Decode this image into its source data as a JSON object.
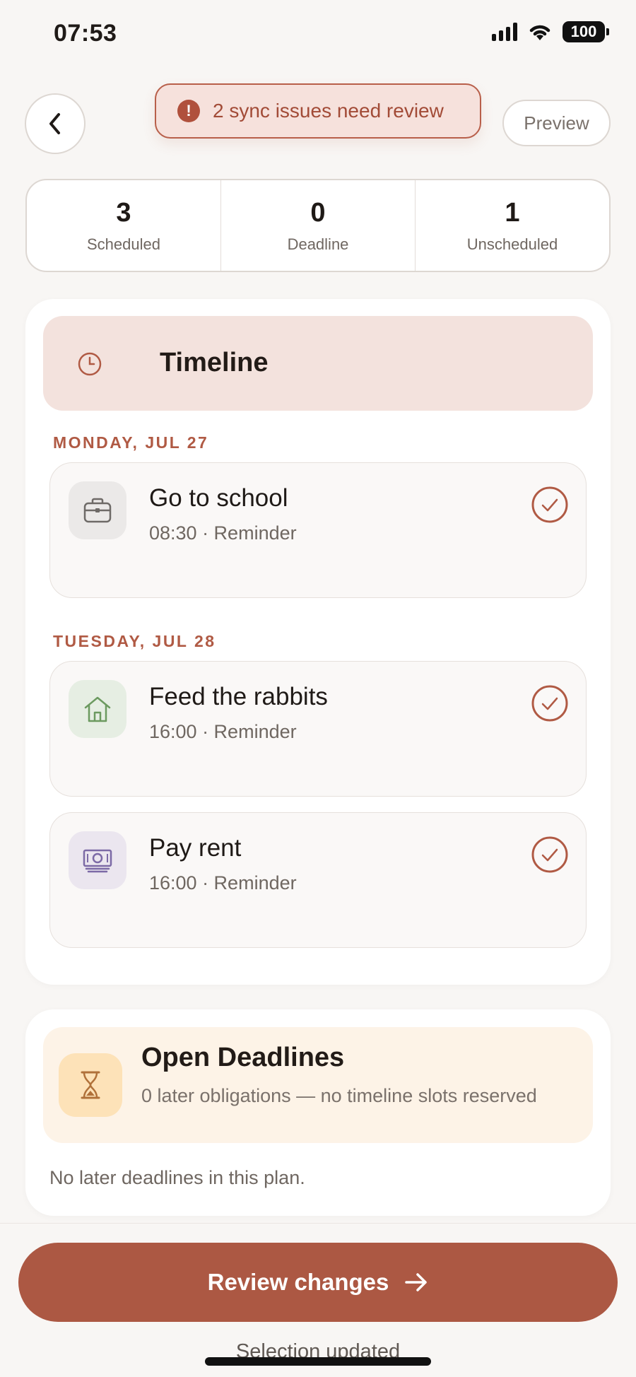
{
  "status_bar": {
    "time": "07:53",
    "battery": "100"
  },
  "header": {
    "sync_banner": "2 sync issues need review",
    "sync_icon_glyph": "!",
    "preview_label": "Preview"
  },
  "stats": [
    {
      "value": "3",
      "label": "Scheduled"
    },
    {
      "value": "0",
      "label": "Deadline"
    },
    {
      "value": "1",
      "label": "Unscheduled"
    }
  ],
  "timeline": {
    "title": "Timeline",
    "days": [
      {
        "label": "MONDAY, JUL 27"
      },
      {
        "label": "TUESDAY, JUL 28"
      }
    ],
    "tasks": [
      {
        "title": "Go to school",
        "subtitle": "08:30 · Reminder",
        "icon": "briefcase-icon"
      },
      {
        "title": "Feed the rabbits",
        "subtitle": "16:00 · Reminder",
        "icon": "house-icon"
      },
      {
        "title": "Pay rent",
        "subtitle": "16:00 · Reminder",
        "icon": "cash-icon"
      }
    ]
  },
  "deadlines": {
    "title": "Open Deadlines",
    "subtitle": "0 later obligations — no timeline slots reserved",
    "empty_text": "No later deadlines in this plan."
  },
  "footer": {
    "review_label": "Review changes",
    "selection_text": "Selection updated"
  },
  "colors": {
    "accent": "#ac5843",
    "accent_text": "#b05a44",
    "timeline_header_bg": "#f3e2dd",
    "deadline_header_bg": "#fdf3e7"
  }
}
